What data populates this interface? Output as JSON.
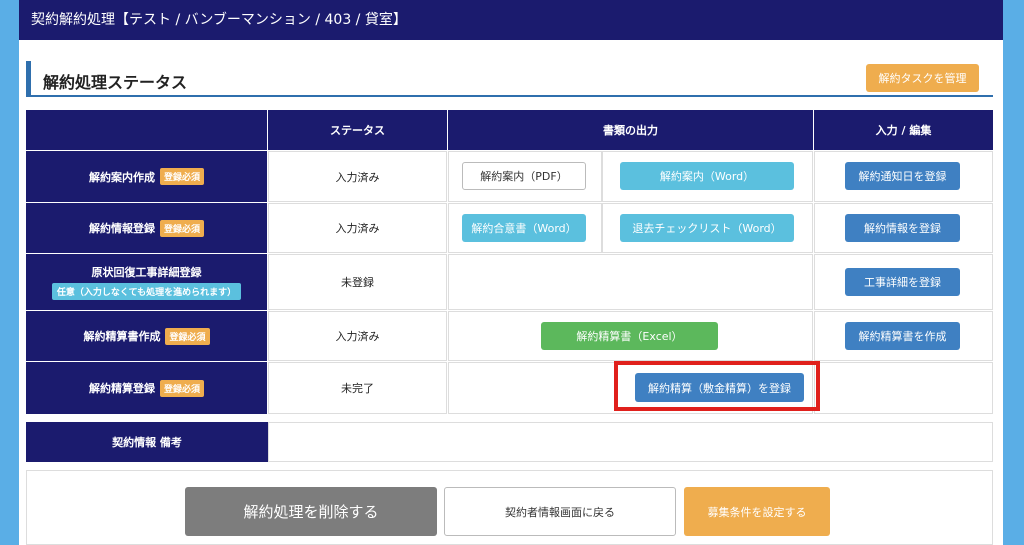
{
  "titlebar": {
    "title": "契約解約処理【テスト / バンブーマンション / 403 / 貸室】"
  },
  "section": {
    "title": "解約処理ステータス",
    "manage_tasks_label": "解約タスクを管理"
  },
  "table": {
    "headers": [
      "",
      "ステータス",
      "書類の出力",
      "入力 / 編集"
    ],
    "rows": [
      {
        "label": "解約案内作成",
        "badge": "登録必須",
        "status": "入力済み",
        "doc1": "解約案内（PDF）",
        "doc2": "解約案内（Word）",
        "action": "解約通知日を登録"
      },
      {
        "label": "解約情報登録",
        "badge": "登録必須",
        "status": "入力済み",
        "doc1": "解約合意書（Word）",
        "doc2": "退去チェックリスト（Word）",
        "action": "解約情報を登録"
      },
      {
        "label": "原状回復工事詳細登録",
        "note": "任意（入力しなくても処理を進められます）",
        "status": "未登録",
        "action": "工事詳細を登録"
      },
      {
        "label": "解約精算書作成",
        "badge": "登録必須",
        "status": "入力済み",
        "doc1": "解約精算書（Excel）",
        "action": "解約精算書を作成"
      },
      {
        "label": "解約精算登録",
        "badge": "登録必須",
        "status": "未完了",
        "doc1": "解約精算（敷金精算）を登録"
      }
    ]
  },
  "remarks": {
    "label": "契約情報 備考",
    "value": ""
  },
  "footer": {
    "delete_label": "解約処理を削除する",
    "back_label": "契約者情報画面に戻る",
    "recruit_label": "募集条件を設定する"
  },
  "colors": {
    "navy": "#1b1b6e",
    "orange": "#efad4e",
    "blue": "#3f80c2",
    "highlight": "#e0201c"
  }
}
